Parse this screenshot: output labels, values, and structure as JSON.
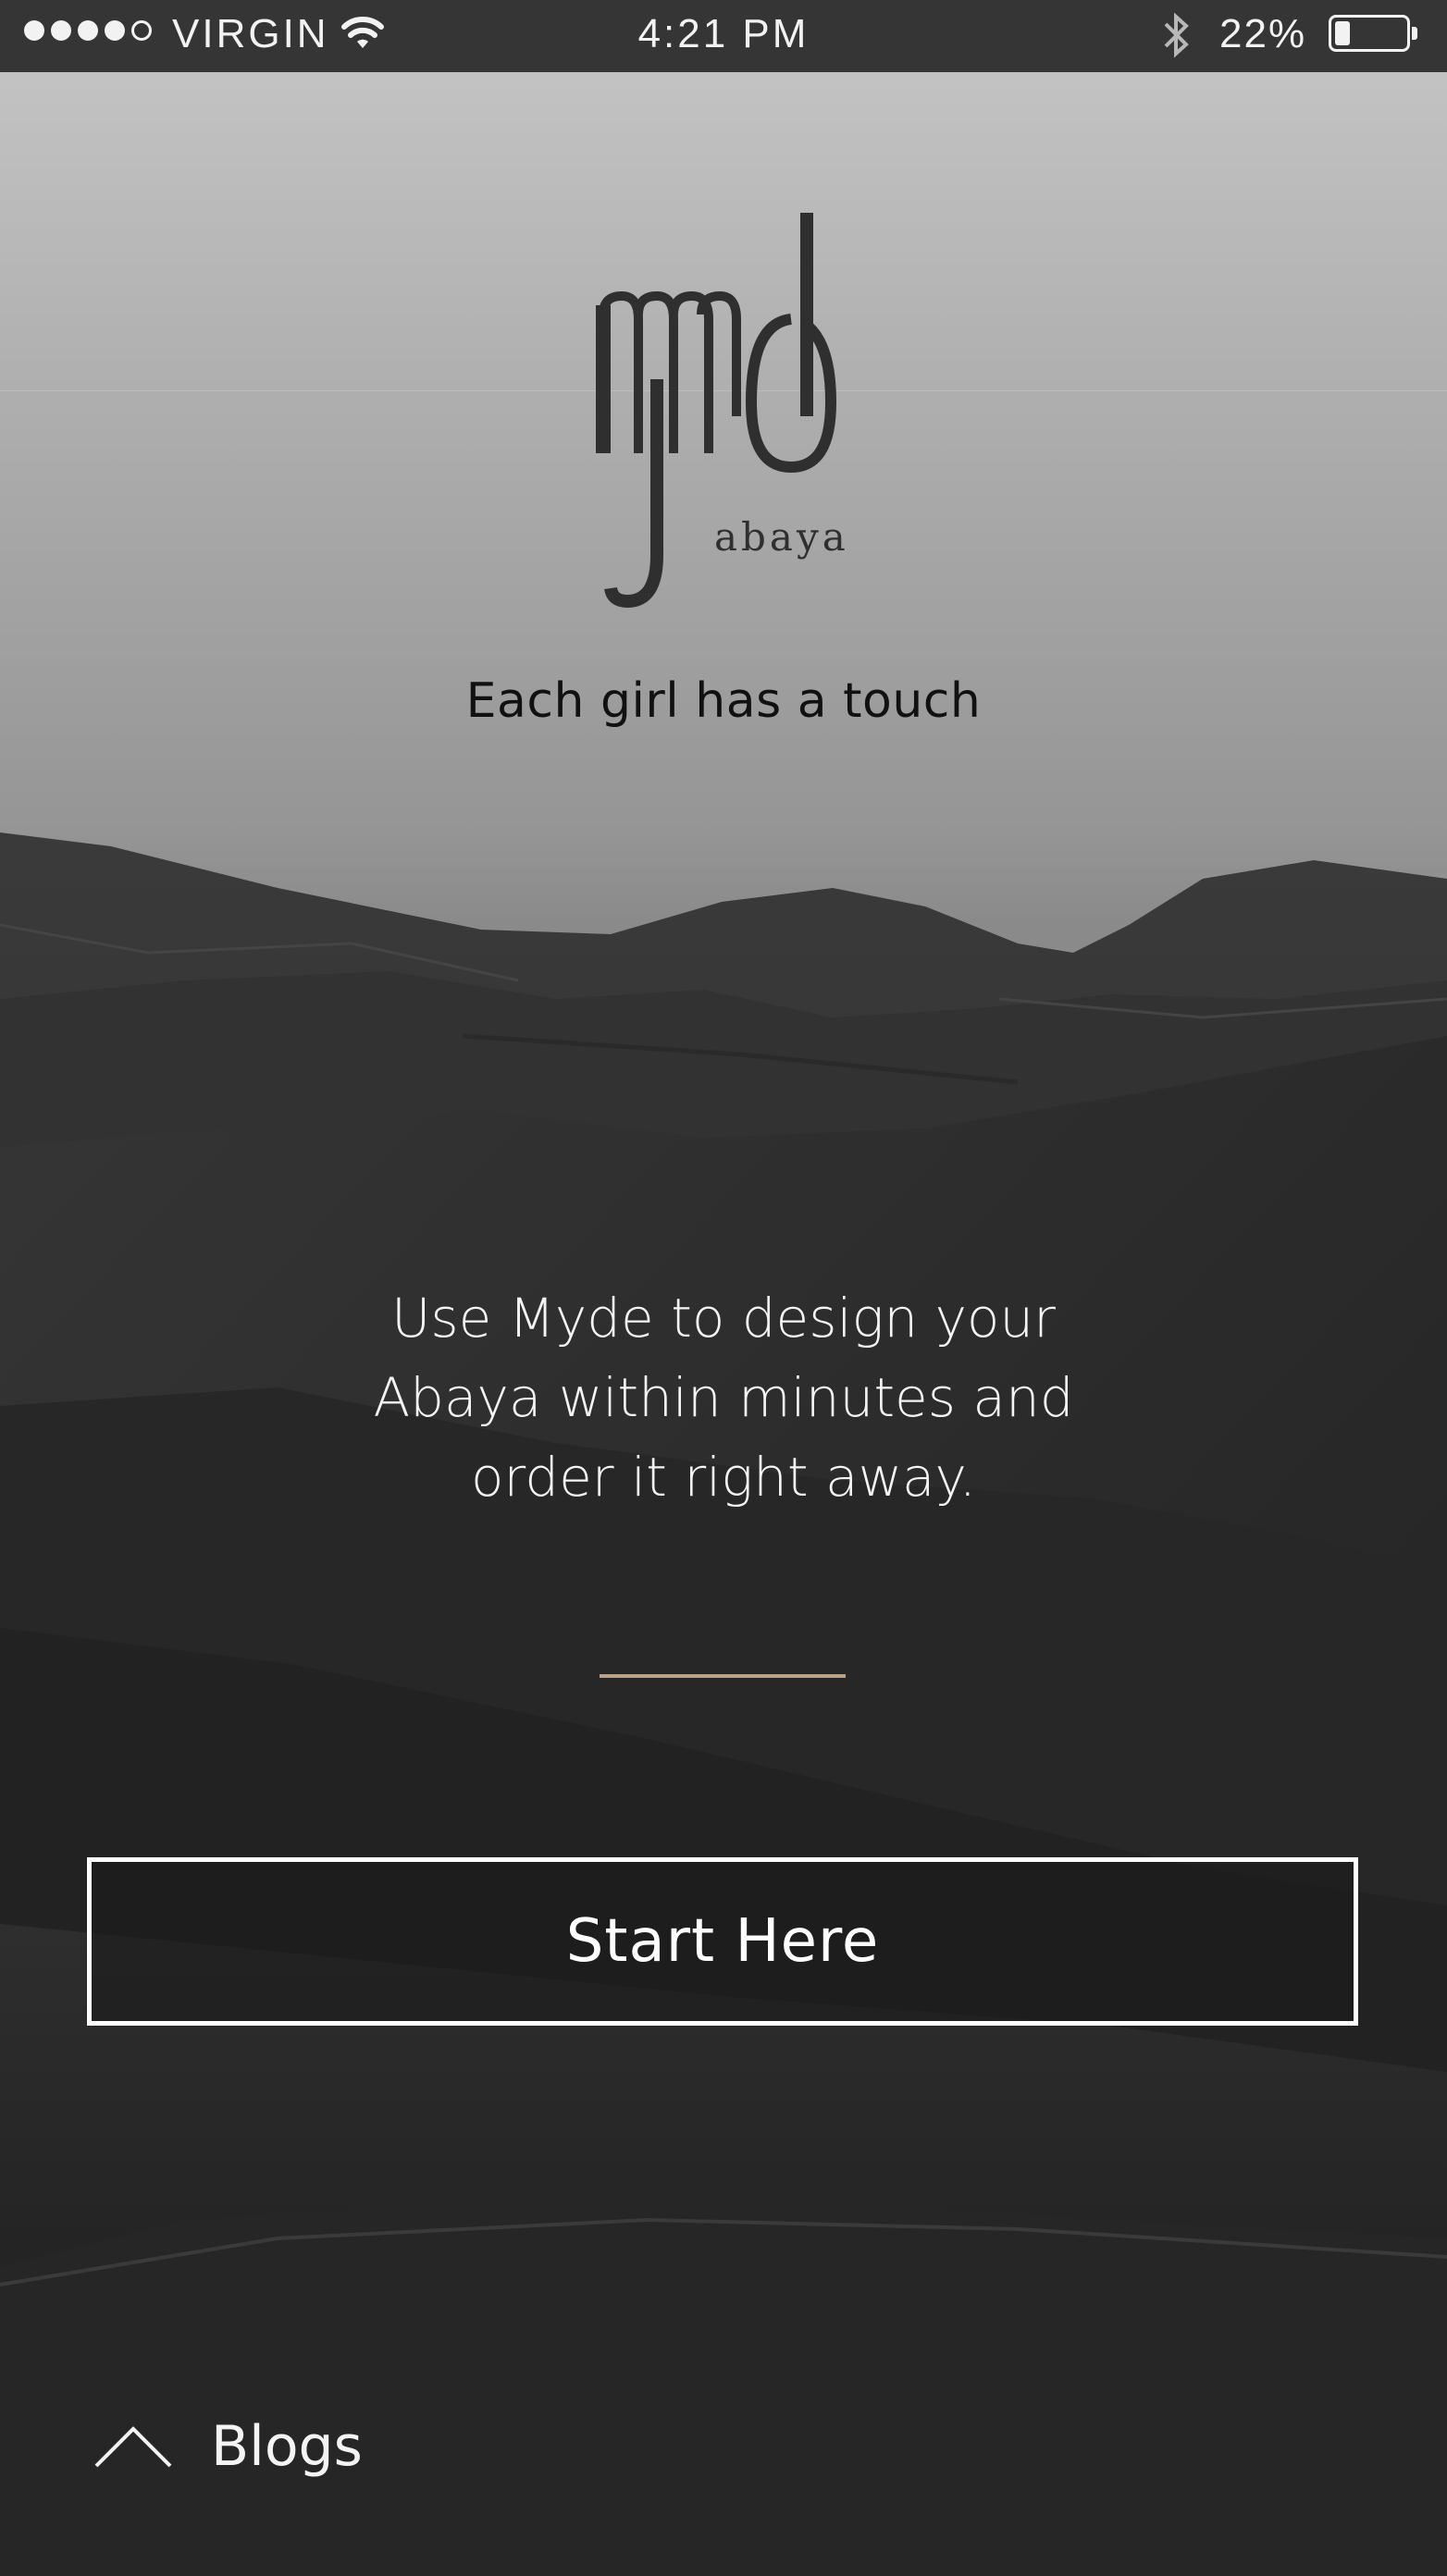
{
  "status_bar": {
    "carrier": "VIRGIN",
    "time": "4:21 PM",
    "battery_percent": "22%",
    "battery_level": 0.22,
    "signal_bars_filled": 4,
    "signal_bars_total": 5,
    "icons": [
      "wifi-icon",
      "bluetooth-icon",
      "battery-icon"
    ]
  },
  "brand": {
    "logo_text": "Myde abaya",
    "tagline": "Each girl has a touch"
  },
  "intro": {
    "lines": [
      "Use Myde to design your",
      "Abaya within minutes and",
      "order it right away."
    ]
  },
  "actions": {
    "start_label": "Start Here",
    "blogs_label": "Blogs"
  },
  "colors": {
    "status_bar_bg": "#353535",
    "divider_accent": "#b8a089",
    "button_border": "#ffffff",
    "sky_top": "#c7c7c7",
    "dune_dark": "#1c1c1c"
  }
}
